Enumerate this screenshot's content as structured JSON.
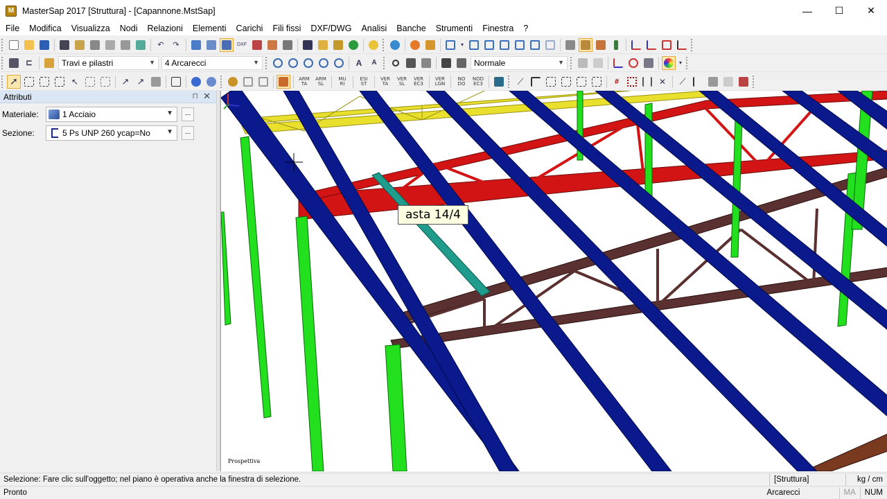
{
  "window": {
    "title": "MasterSap 2017 [Struttura] - [Capannone.MstSap]",
    "app_icon_letter": "M",
    "minimize": "—",
    "maximize": "☐",
    "close": "✕"
  },
  "menu": [
    "File",
    "Modifica",
    "Visualizza",
    "Nodi",
    "Relazioni",
    "Elementi",
    "Carichi",
    "Fili fissi",
    "DXF/DWG",
    "Analisi",
    "Banche",
    "Strumenti",
    "Finestra",
    "?"
  ],
  "toolbar2": {
    "element_type": "Travi e pilastri",
    "group": "4 Arcarecci",
    "view_mode": "Normale"
  },
  "toolbar3_text_buttons": [
    [
      "ARM",
      "TA"
    ],
    [
      "ARM",
      "SL"
    ],
    [
      "MU",
      "RI"
    ],
    [
      "ESI",
      "ST"
    ],
    [
      "VER",
      "TA"
    ],
    [
      "VER",
      "SL"
    ],
    [
      "VER",
      "EC3"
    ],
    [
      "VER",
      "LGN"
    ],
    [
      "NO",
      "DO"
    ],
    [
      "NOD",
      "EC3"
    ]
  ],
  "panel": {
    "title": "Attributi",
    "pin": "⊓",
    "close": "✕",
    "material_label": "Materiale:",
    "material_value": "1 Acciaio",
    "section_label": "Sezione:",
    "section_value": "5 Ps UNP 260 ycap=No",
    "dots": "..."
  },
  "viewport": {
    "tooltip": "asta 14/4",
    "view_label": "Prospettiva"
  },
  "status": {
    "hint": "Selezione: Fare clic sull'oggetto; nel piano è operativa anche la finestra di selezione.",
    "context": "[Struttura]",
    "units": "kg / cm",
    "ready": "Pronto",
    "group": "Arcarecci",
    "caps": "MA",
    "num": "NUM"
  },
  "colors": {
    "purlin": "#0a1a8c",
    "column": "#22e01e",
    "truss_red": "#d31414",
    "truss_yellow": "#e8e02c",
    "truss_brown": "#5a3030",
    "selected_member": "#1f9c8c"
  }
}
